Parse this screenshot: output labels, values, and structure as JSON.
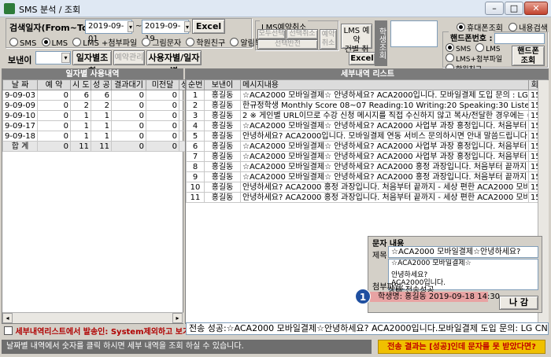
{
  "window": {
    "title": "SMS 분석 / 조회",
    "minimize": "–",
    "maximize": "□",
    "close": "✕"
  },
  "search": {
    "date_label": "검색일자(From~To)",
    "date_from": "2019-09-01",
    "tilde": "~",
    "date_to": "2019-09-19",
    "excel": "Excel",
    "types": [
      "SMS",
      "LMS",
      "LMS +첨부파일",
      "그림문자",
      "학원친구",
      "알림톡"
    ],
    "sender_label": "보낸이",
    "btn_daily": "일자별조회",
    "btn_manage": "예약관리",
    "btn_user_daily": "사용자별/일자별"
  },
  "reserve": {
    "title": "LMS예약취소",
    "cancel_all": "모두선택",
    "cancel_sel": "선택취소",
    "view_sel": "선택반전",
    "reserve_cancel": "예약\n취소",
    "lms_reserve": "LMS 예약\n건별 취소",
    "excel": "Excel",
    "side_tab": "학생조회"
  },
  "phone_search": {
    "opt_mobile": "휴대폰조회",
    "opt_content": "내용검색",
    "label": "핸드폰번호 :",
    "types": [
      "SMS",
      "LMS",
      "LMS+첨부파일",
      "학원친구"
    ],
    "btn": "핸드폰\n조회"
  },
  "left_panel": {
    "title": "일자별 사용내역",
    "headers": [
      "날 짜",
      "예 약",
      "시 도",
      "성 공",
      "결과대기",
      "미전달",
      "성"
    ],
    "rows": [
      [
        "9-09-03",
        "0",
        "6",
        "6",
        "0",
        "0"
      ],
      [
        "9-09-09",
        "0",
        "2",
        "2",
        "0",
        "0"
      ],
      [
        "9-09-10",
        "0",
        "1",
        "1",
        "0",
        "0"
      ],
      [
        "9-09-17",
        "0",
        "1",
        "1",
        "0",
        "0"
      ],
      [
        "9-09-18",
        "0",
        "1",
        "1",
        "0",
        "0"
      ]
    ],
    "total": [
      "합 계",
      "0",
      "11",
      "11",
      "0",
      "0"
    ],
    "footer_check": "세부내역리스트에서 발송인: System제외하고 보기"
  },
  "right_panel": {
    "title": "세부내역 리스트",
    "headers": [
      "순번",
      "보낸이",
      "메시지내용",
      "회신"
    ],
    "rows": [
      [
        "1",
        "홍길동",
        "☆ACA2000 모바일결제☆ 안녕하세요? ACA2000입니다. 모바일결제 도입 문의 : LG CNS 1661-8",
        "1599"
      ],
      [
        "2",
        "홍길동",
        "한규정학생 Monthly Score 08~07 Reading:10 Writing:20 Speaking:30 Listening:40 평균:25 석차:",
        "1599"
      ],
      [
        "3",
        "홍길동",
        "2 ※ 게인별 URL이므로 수강 신청 메시지를 직접 수신하지 않고 복사/전달한 경우에는 수강 신청불",
        "1599"
      ],
      [
        "4",
        "홍길동",
        "☆ACA2000 모바일결제☆ 안녕하세요? ACA2000 사업부 과장 홍정입니다. 처음부터 끝까지 - 세상",
        "1599"
      ],
      [
        "5",
        "홍길동",
        "안녕하세요? ACA2000입니다. 모바일결제 연동 서비스 문의하시면 안내 말씀드립니다. LG CN",
        "1599"
      ],
      [
        "6",
        "홍길동",
        "☆ACA2000 모바일결제☆ 안녕하세요? ACA2000 사업부 과장 홍정입니다. 처음부터 끝까지 - 세상",
        "1599"
      ],
      [
        "7",
        "홍길동",
        "☆ACA2000 모바일결제☆ 안녕하세요? ACA2000 사업부 과장 홍정입니다. 처음부터 끝까지 - 세상",
        "1599"
      ],
      [
        "8",
        "홍길동",
        "☆ACA2000 모바일결제☆ 안녕하세요? ACA2000 홍정 과장입니다. 처음부터 끝까지 - 세상 편한 A",
        "1599"
      ],
      [
        "9",
        "홍길동",
        "☆ACA2000 모바일결제☆ 안녕하세요? ACA2000 홍정 과장입니다. 처음부터 끝까지 - 세상 편한 A",
        "1599"
      ],
      [
        "10",
        "홍길동",
        "안녕하세요? ACA2000 홍정 과장입니다. 처음부터 끝까지 - 세상 편한 ACA2000 모바일결제 ♣(AC",
        "1599"
      ],
      [
        "11",
        "홍길동",
        "안녕하세요? ACA2000 홍정 과장입니다. 처음부터 끝까지 - 세상 편한 ACA2000 모바일결제 ♣(AC",
        "1599"
      ]
    ]
  },
  "message_popup": {
    "title": "문자 내용",
    "subject_label": "제목",
    "subject": "☆ACA2000 모바일결제☆안녕하세요?",
    "body_lines": [
      "☆ACA2000 모바일결제☆",
      "",
      "안녕하세요?",
      "ACA2000입니다.",
      "",
      "모바일결제 도입 문의",
      ": LG CNS 1661-8455"
    ],
    "attach_label": "첨부파일:",
    "state": "상태:전송성공",
    "student": "학생명: 홍길동     2019-09-18 14:30",
    "close_btn": "나 감",
    "marker": "1"
  },
  "bottom_text": "전송 성공:☆ACA2000 모바일결제☆안녕하세요? ACA2000입니다.모바일결제 도입 문의: LG CNS 166",
  "status": {
    "left": "날짜별 내역에서 숫자를 클릭 하시면 세부 내역을 조회 하실 수 있습니다.",
    "right": "전송 결과는 [성공]인데 문자를 못 받았다면?"
  }
}
